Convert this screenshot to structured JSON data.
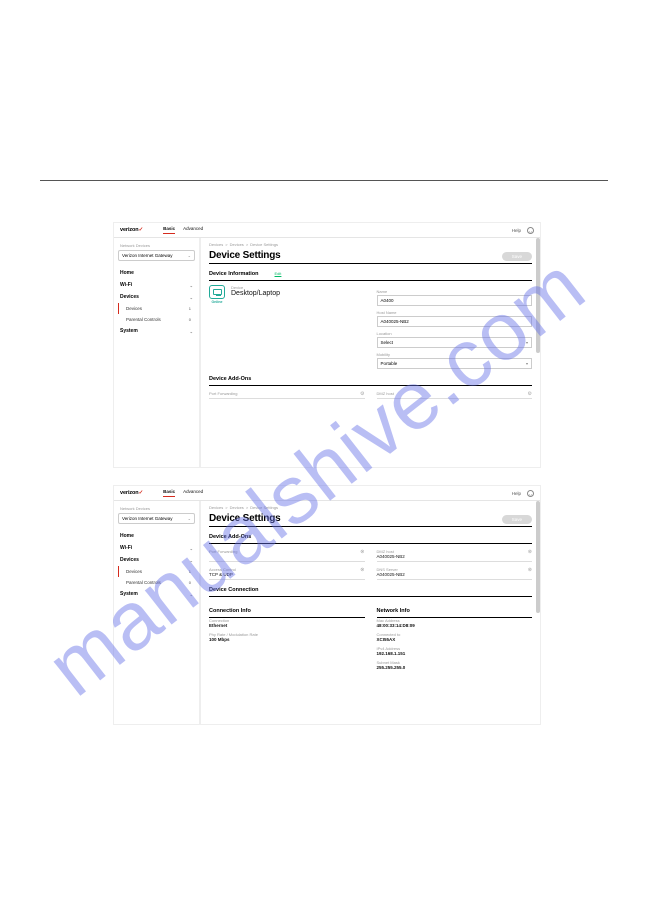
{
  "watermark": "manualshive.com",
  "common": {
    "brand": "verizon",
    "tabs": {
      "basic": "Basic",
      "advanced": "Advanced"
    },
    "help": "Help",
    "user_icon": "⊙",
    "gw_label": "Network Devices",
    "gw_value": "Verizon Internet Gateway",
    "nav": {
      "home": "Home",
      "wifi": "Wi-Fi",
      "devices": "Devices",
      "parental": "Parental Controls",
      "system": "System",
      "devices_sub": "Devices",
      "devices_badge": "1",
      "parental_badge": "0"
    },
    "crumbs": {
      "a": "Devices",
      "b": "Devices",
      "c": "Device Settings",
      "sep": ">"
    },
    "page_title": "Device Settings",
    "save": "Save"
  },
  "s1": {
    "dev_info_header": "Device Information",
    "edit": "Edit",
    "online": "Online",
    "dev_label": "Device",
    "dev_type": "Desktop/Laptop",
    "name_label": "Name",
    "name_value": "A0400",
    "host_label": "Host Name",
    "host_value": "A040025-NB2",
    "location_label": "Location",
    "location_value": "Select",
    "mobility_label": "Mobility",
    "mobility_value": "Portable",
    "addons_header": "Device Add-Ons",
    "addon_left_label": "Port Forwarding",
    "addon_right_label": "DMZ host",
    "addon_right_value": ""
  },
  "s2": {
    "addons_header": "Device Add-Ons",
    "pf_label": "Port Forwarding",
    "pf_value": "",
    "ac_label": "Access Control",
    "ac_value": "TCP & UDP",
    "dmz_label": "DMZ host",
    "dmz_value": "A040025-NB2",
    "dns_label": "DNS Server",
    "dns_value": "A040025-NB2",
    "dc_header": "Device Connection",
    "ci_header": "Connection Info",
    "ni_header": "Network Info",
    "ci": {
      "conn_label": "Connection",
      "conn_value": "Ethernet",
      "rate_label": "Phy Rate / Modulation Rate",
      "rate_value": "100 Mbps"
    },
    "ni": {
      "mac_label": "Mac Address",
      "mac_value": "48:00:33:14:D8:09",
      "connected_label": "Connected to",
      "connected_value": "XCI55AX",
      "ipv4_label": "IPv4 Address",
      "ipv4_value": "192.168.1.151",
      "subnet_label": "Subnet Mask",
      "subnet_value": "255.255.255.0"
    }
  }
}
